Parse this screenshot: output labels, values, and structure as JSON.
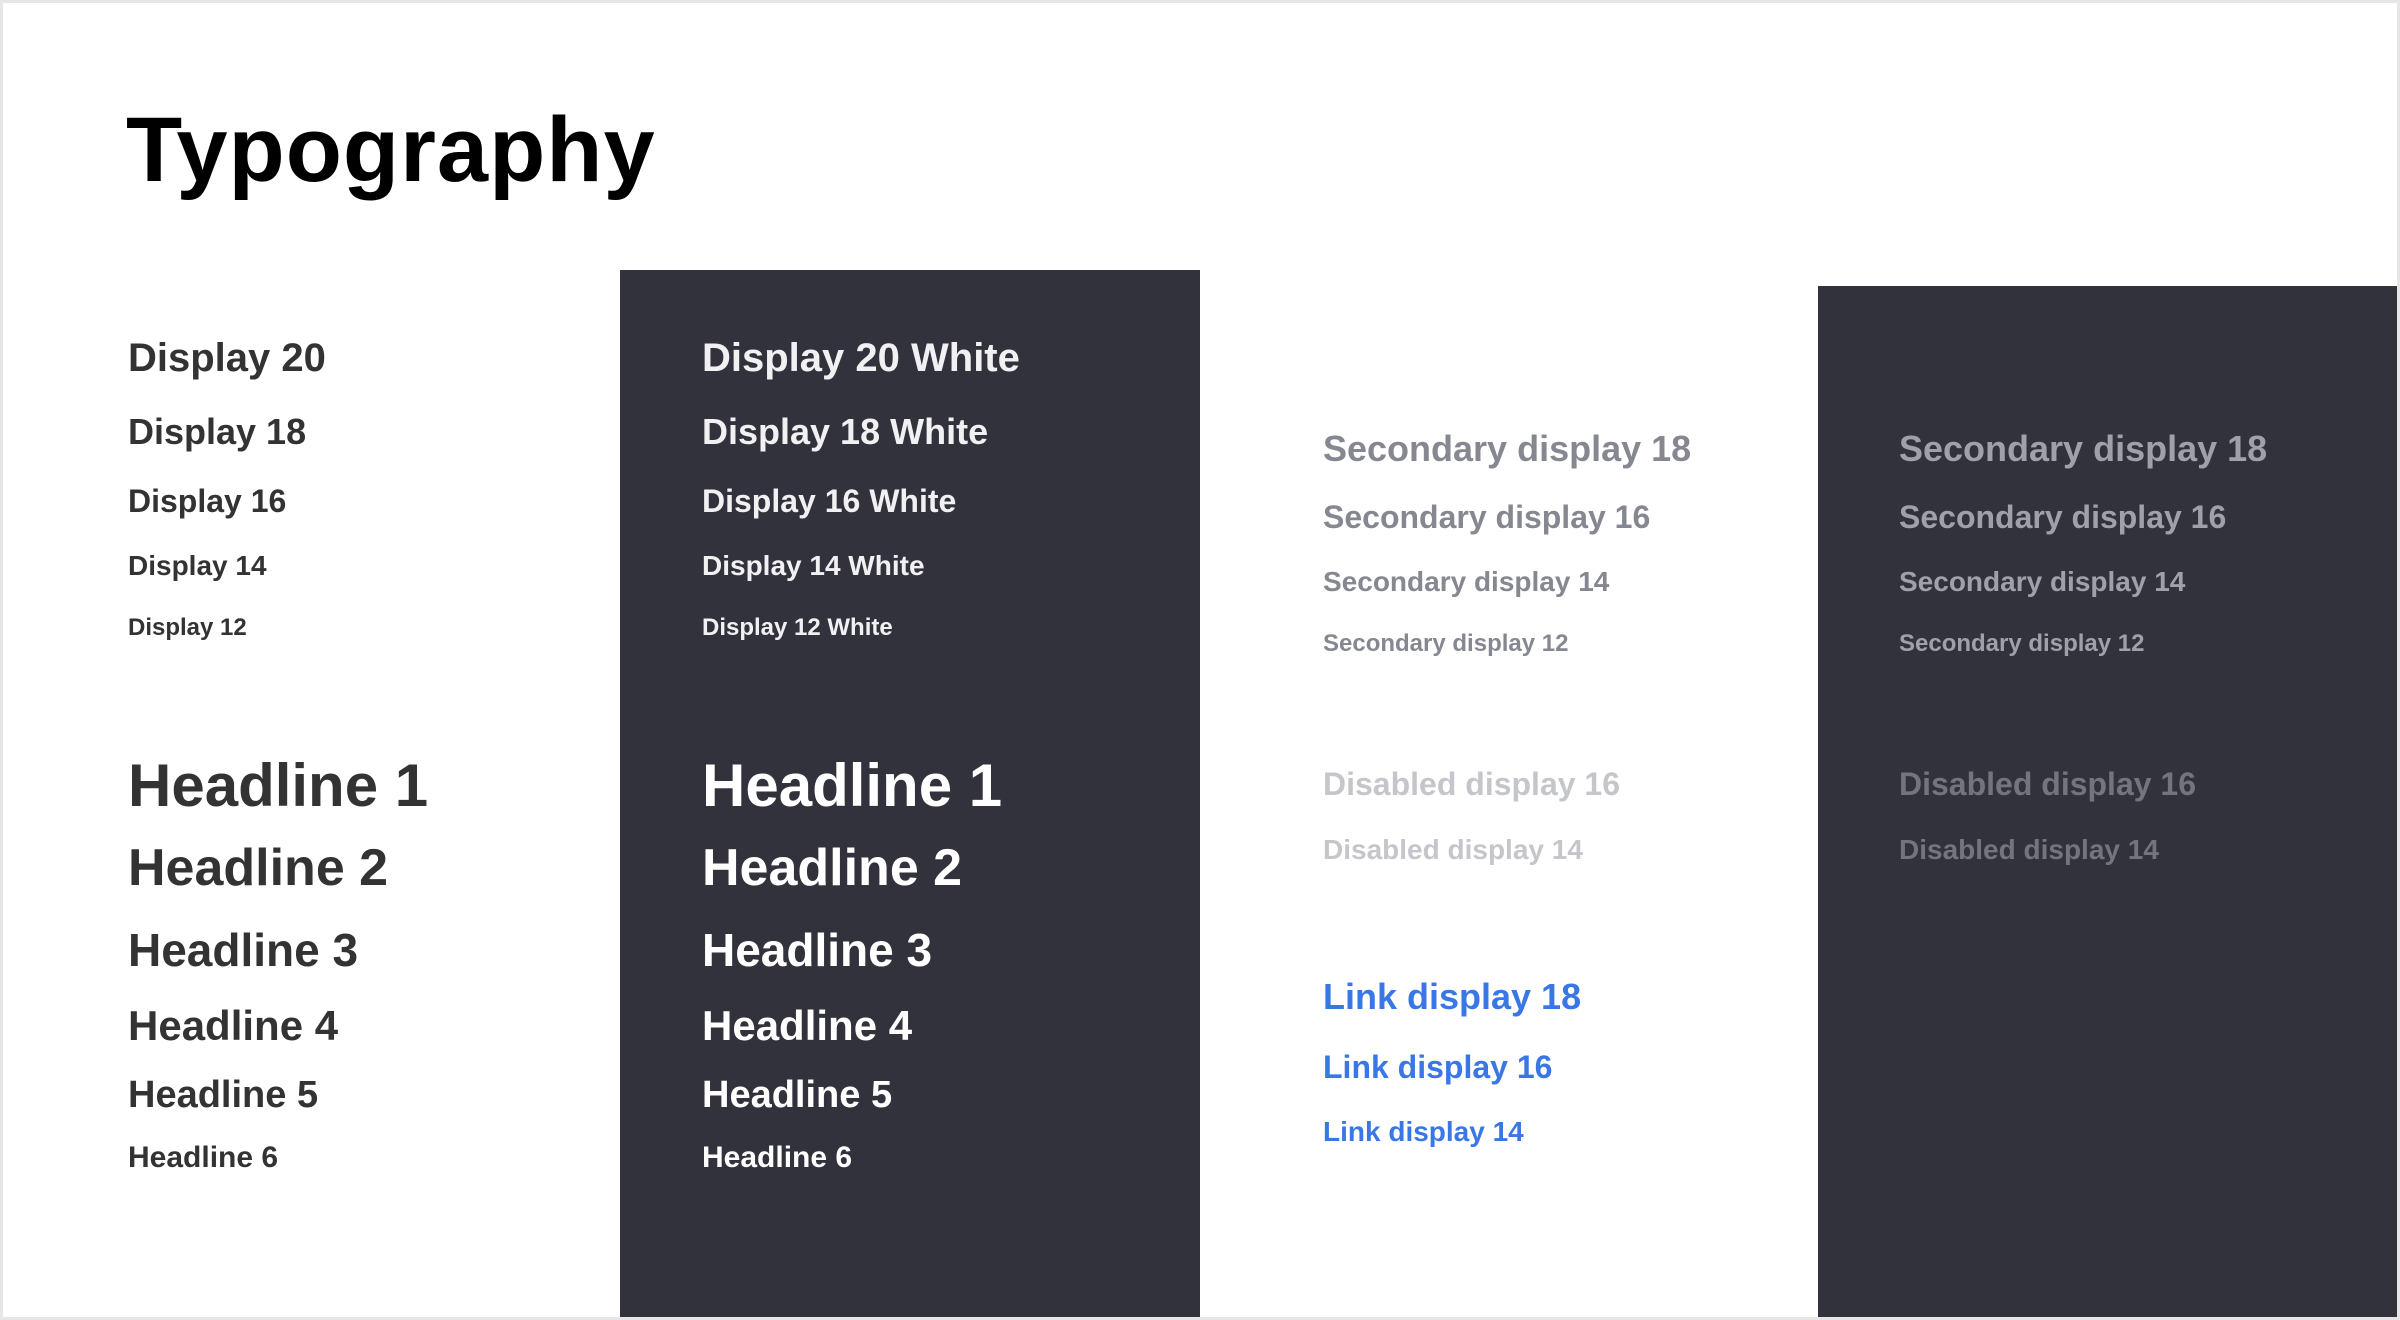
{
  "page": {
    "title": "Typography"
  },
  "colors": {
    "text_primary": "#333333",
    "text_title": "#000000",
    "dark_panel": "#32323c",
    "text_white": "#ffffff",
    "text_secondary": "#858890",
    "text_secondary_on_dark": "#a0a1a8",
    "text_disabled": "#c5c6cb",
    "text_disabled_on_dark": "#74757c",
    "link": "#3a77e6"
  },
  "light_column": {
    "display": [
      "Display 20",
      "Display 18",
      "Display 16",
      "Display 14",
      "Display 12"
    ],
    "headlines": [
      "Headline 1",
      "Headline 2",
      "Headline 3",
      "Headline 4",
      "Headline 5",
      "Headline 6"
    ]
  },
  "dark_column": {
    "display": [
      "Display 20 White",
      "Display 18 White",
      "Display 16 White",
      "Display 14 White",
      "Display 12 White"
    ],
    "headlines": [
      "Headline 1",
      "Headline 2",
      "Headline 3",
      "Headline 4",
      "Headline 5",
      "Headline 6"
    ]
  },
  "secondary_light_column": {
    "secondary": [
      "Secondary display 18",
      "Secondary display 16",
      "Secondary display 14",
      "Secondary display 12"
    ],
    "disabled": [
      "Disabled display 16",
      "Disabled display 14"
    ],
    "links": [
      "Link display 18",
      "Link display 16",
      "Link display 14"
    ]
  },
  "secondary_dark_column": {
    "secondary": [
      "Secondary display 18",
      "Secondary display 16",
      "Secondary display 14",
      "Secondary display 12"
    ],
    "disabled": [
      "Disabled display 16",
      "Disabled display 14"
    ]
  }
}
